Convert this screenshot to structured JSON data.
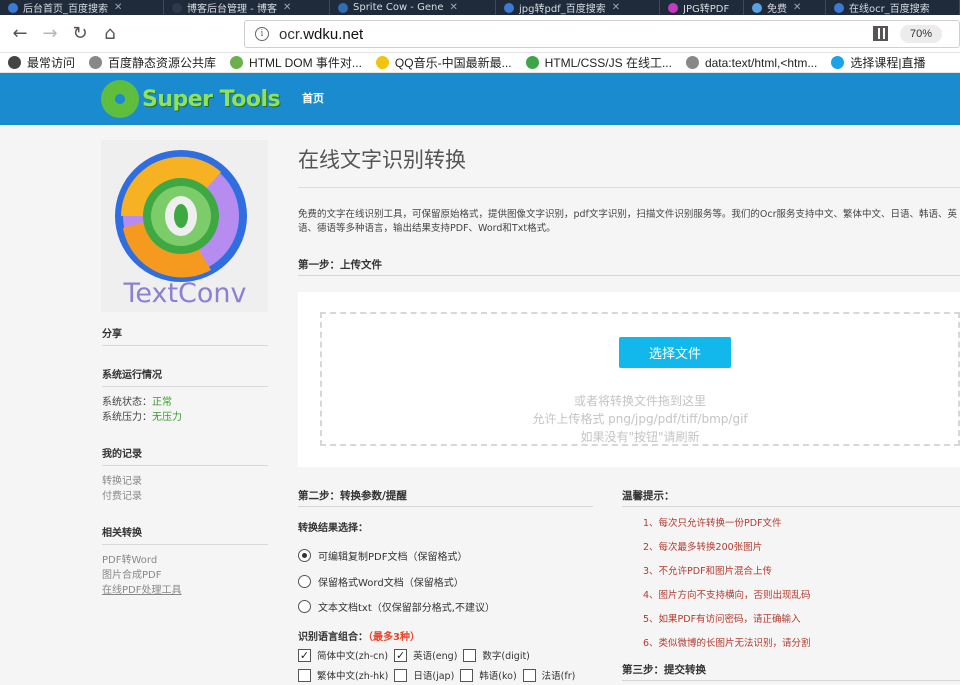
{
  "browser": {
    "tabs": [
      {
        "label": "后台首页_百度搜索",
        "close": "✕",
        "active": false,
        "color": "#3a7bd5"
      },
      {
        "label": "博客后台管理 - 博客",
        "close": "✕",
        "active": false,
        "color": "#2d3a4b"
      },
      {
        "label": "Sprite Cow - Gene",
        "close": "✕",
        "active": false,
        "color": "#2f6db5"
      },
      {
        "label": "jpg转pdf_百度搜索",
        "close": "✕",
        "active": false,
        "color": "#3a7bd5"
      },
      {
        "label": "JPG转PDF",
        "close": "",
        "active": false,
        "color": "#c43bbf"
      },
      {
        "label": "免费",
        "close": "✕",
        "active": false,
        "color": "#5aa1e3"
      },
      {
        "label": "在线ocr_百度搜索",
        "close": "",
        "active": false,
        "color": "#3a7bd5"
      }
    ],
    "url_prefix": "ocr.",
    "url_domain": "wdku.net",
    "zoom": "70%",
    "bookmarks": [
      {
        "label": "最常访问",
        "color": "#444444"
      },
      {
        "label": "百度静态资源公共库",
        "color": "#888888"
      },
      {
        "label": "HTML DOM 事件对...",
        "color": "#6bb04a"
      },
      {
        "label": "QQ音乐-中国最新最...",
        "color": "#f2c40f"
      },
      {
        "label": "HTML/CSS/JS 在线工...",
        "color": "#3ca548"
      },
      {
        "label": "data:text/html,<htm...",
        "color": "#888888"
      },
      {
        "label": "选择课程|直播",
        "color": "#1aa3e8"
      }
    ]
  },
  "site": {
    "logo_text": "Super Tools",
    "nav_home": "首页",
    "header_color": "#1b8bd0"
  },
  "sidebar": {
    "logo_text": "TextConv",
    "share_title": "分享",
    "status_title": "系统运行情况",
    "status_label": "系统状态：",
    "status_value": "正常",
    "load_label": "系统压力：",
    "load_value": "无压力",
    "records_title": "我的记录",
    "records": [
      "转换记录",
      "付费记录"
    ],
    "related_title": "相关转换",
    "related": [
      "PDF转Word",
      "图片合成PDF",
      "在线PDF处理工具"
    ]
  },
  "main": {
    "title": "在线文字识别转换",
    "description": "免费的文字在线识别工具，可保留原始格式，提供图像文字识别，pdf文字识别，扫描文件识别服务等。我们的Ocr服务支持中文、繁体中文、日语、韩语、英语、德语等多种语言，输出结果支持PDF、Word和Txt格式。",
    "step1_title": "第一步：上传文件",
    "choose_button": "选择文件",
    "drop_hint_1": "或者将转换文件拖到这里",
    "drop_hint_2": "允许上传格式  png/jpg/pdf/tiff/bmp/gif",
    "drop_hint_3": "如果没有\"按钮\"请刷新",
    "step2_title": "第二步：转换参数/提醒",
    "result_label": "转换结果选择：",
    "options": [
      {
        "label": "可编辑复制PDF文档（保留格式）",
        "selected": true
      },
      {
        "label": "保留格式Word文档（保留格式）",
        "selected": false
      },
      {
        "label": "文本文档txt（仅保留部分格式,不建议）",
        "selected": false
      }
    ],
    "lang_label": "识别语言组合：",
    "lang_limit": "（最多3种）",
    "languages_row1": [
      {
        "label": "简体中文(zh-cn)",
        "checked": true
      },
      {
        "label": "英语(eng)",
        "checked": true
      },
      {
        "label": "数字(digit)",
        "checked": false
      }
    ],
    "languages_row2": [
      {
        "label": "繁体中文(zh-hk)",
        "checked": false
      },
      {
        "label": "日语(jap)",
        "checked": false
      },
      {
        "label": "韩语(ko)",
        "checked": false
      },
      {
        "label": "法语(fr)",
        "checked": false
      }
    ],
    "tips_title": "温馨提示：",
    "tips": [
      "1、每次只允许转换一份PDF文件",
      "2、每次最多转换200张图片",
      "3、不允许PDF和图片混合上传",
      "4、图片方向不支持横向，否则出现乱码",
      "5、如果PDF有访问密码，请正确输入",
      "6、类似微博的长图片无法识别，请分割"
    ],
    "step3_title": "第三步：提交转换"
  }
}
